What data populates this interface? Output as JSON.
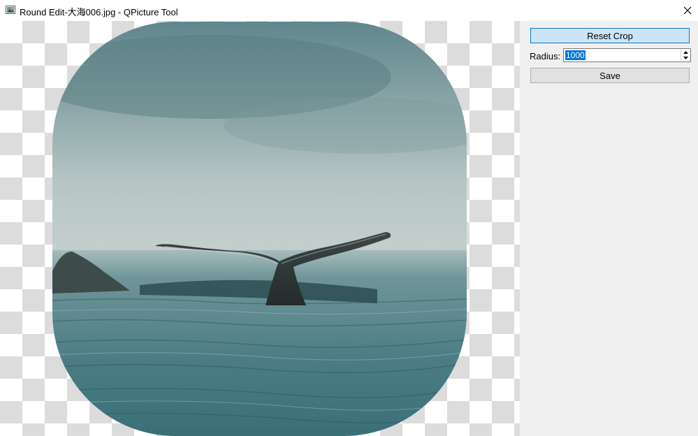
{
  "window": {
    "title": "Round Edit-大海006.jpg - QPicture Tool",
    "app_icon": "picture-icon",
    "close_icon": "close-icon"
  },
  "canvas": {
    "background": "checkerboard-transparency",
    "image": "whale-tail-ocean-photo",
    "image_colors": {
      "sky": "#93abac",
      "water": "#4f7d83",
      "tail": "#2f3b3a"
    }
  },
  "panel": {
    "reset_crop_label": "Reset Crop",
    "radius_label": "Radius:",
    "radius_value": "1000",
    "save_label": "Save"
  },
  "colors": {
    "accent": "#0078d7",
    "panel_bg": "#f0f0f0",
    "checker": "#dcdcdc"
  }
}
